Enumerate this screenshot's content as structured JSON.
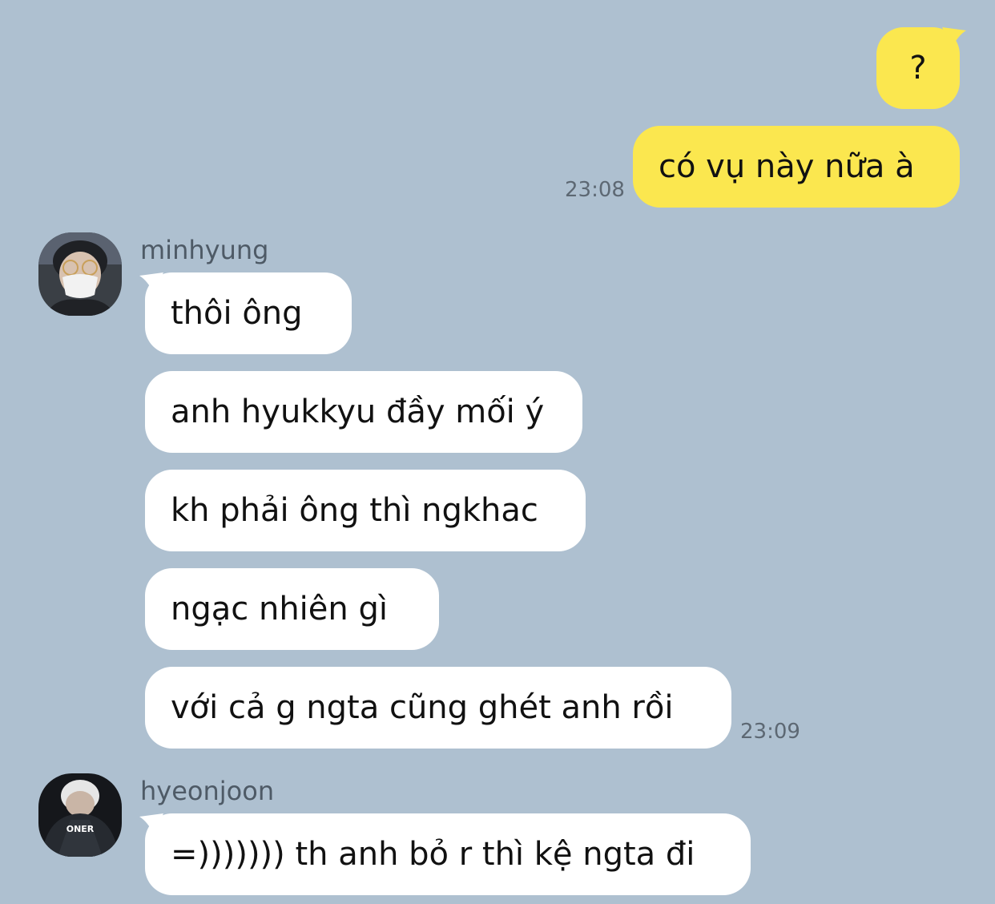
{
  "conversation": {
    "outgoing": {
      "messages": [
        "?",
        "có vụ này nữa à"
      ],
      "time": "23:08"
    },
    "groups": [
      {
        "sender": "minhyung",
        "avatar_icon": "person-with-mask-icon",
        "messages": [
          "thôi ông",
          "anh hyukkyu đầy mối ý",
          "kh phải ông thì ngkhac",
          "ngạc nhiên gì",
          "với cả g ngta cũng ghét anh rồi"
        ],
        "time": "23:09"
      },
      {
        "sender": "hyeonjoon",
        "avatar_icon": "person-in-jersey-icon",
        "avatar_text": "ONER",
        "messages": [
          "=))))))) th anh bỏ r thì kệ ngta đi"
        ]
      }
    ]
  },
  "colors": {
    "background": "#aec0d0",
    "outgoing_bubble": "#fbe74f",
    "incoming_bubble": "#ffffff",
    "timestamp": "#5d6873",
    "sender_name": "#4e5a66"
  }
}
